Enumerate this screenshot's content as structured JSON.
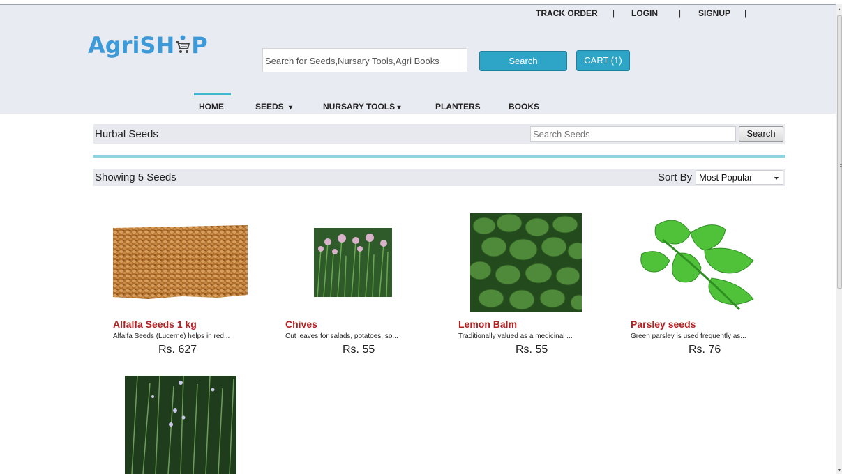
{
  "header": {
    "top_links": [
      "TRACK ORDER",
      "|",
      "LOGIN",
      "|",
      "SIGNUP",
      "|"
    ],
    "logo_text_left": "AgriSH",
    "logo_text_right": "P",
    "search_placeholder": "Search for Seeds,Nursary Tools,Agri Books",
    "search_button": "Search",
    "cart_button": "CART (1)"
  },
  "nav": {
    "items": [
      {
        "label": "HOME"
      },
      {
        "label": "SEEDS",
        "caret": "▾"
      },
      {
        "label": "NURSARY TOOLS",
        "caret": "▾"
      },
      {
        "label": "PLANTERS"
      },
      {
        "label": "BOOKS"
      }
    ]
  },
  "category_bar": {
    "title": "Hurbal Seeds",
    "search_placeholder": "Search Seeds",
    "search_button": "Search"
  },
  "listing": {
    "count_text": "Showing 5 Seeds",
    "sort_label": "Sort By",
    "sort_selected": "Most Popular"
  },
  "products": [
    {
      "name": "Alfalfa Seeds 1 kg",
      "desc": "Alfalfa Seeds (Lucerne) helps in red...",
      "price": "Rs. 627"
    },
    {
      "name": "Chives",
      "desc": "Cut leaves for salads, potatoes, so...",
      "price": "Rs. 55"
    },
    {
      "name": "Lemon Balm",
      "desc": "Traditionally valued as a medicinal ...",
      "price": "Rs. 55"
    },
    {
      "name": "Parsley seeds",
      "desc": "Green parsley is used frequently as...",
      "price": "Rs. 76"
    }
  ],
  "colors": {
    "header_bg": "#e9ebf2",
    "accent_teal": "#2ea5c6",
    "logo_blue": "#3d9ad8",
    "product_name_red": "#b22222"
  }
}
